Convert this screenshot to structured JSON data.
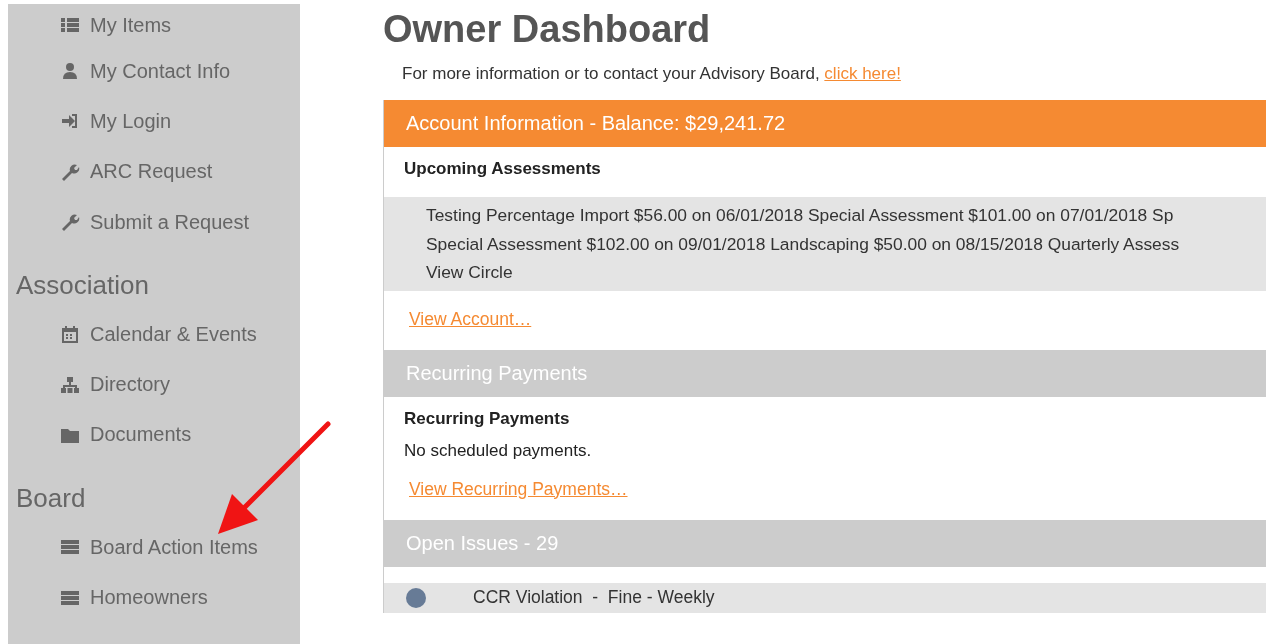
{
  "sidebar": {
    "groups": [
      {
        "items": [
          {
            "label": "My Items",
            "kind": "list"
          },
          {
            "label": "My Contact Info",
            "kind": "user"
          },
          {
            "label": "My Login",
            "kind": "login"
          },
          {
            "label": "ARC Request",
            "kind": "wrench"
          },
          {
            "label": "Submit a Request",
            "kind": "wrench"
          }
        ]
      },
      {
        "heading": "Association",
        "items": [
          {
            "label": "Calendar & Events",
            "kind": "calendar"
          },
          {
            "label": "Directory",
            "kind": "sitemap"
          },
          {
            "label": "Documents",
            "kind": "folder"
          }
        ]
      },
      {
        "heading": "Board",
        "items": [
          {
            "label": "Board Action Items",
            "kind": "server"
          },
          {
            "label": "Homeowners",
            "kind": "server"
          }
        ]
      }
    ]
  },
  "page": {
    "title": "Owner Dashboard",
    "intro": "For more information or to contact your Advisory Board,",
    "intro_link": "click here!"
  },
  "panels": [
    {
      "header": "Account Information - Balance: $29,241.72",
      "color": "#f58a32",
      "subheading": "Upcoming Assessments",
      "lines": [
        "Testing Percentage Import $56.00 on 06/01/2018 Special Assessment $101.00 on 07/01/2018 Sp",
        "Special Assessment $102.00 on 09/01/2018 Landscaping $50.00 on 08/15/2018 Quarterly Assess",
        "View Circle"
      ],
      "link": "View Account…"
    },
    {
      "header": "Recurring Payments",
      "color": "#cccccc",
      "subheading": "Recurring Payments",
      "text": "No scheduled payments.",
      "link": "View Recurring Payments…"
    },
    {
      "header": "Open Issues - 29",
      "color": "#cccccc",
      "issues": [
        {
          "label": "CCR Violation  -  Fine - Weekly",
          "color": "#677b96"
        }
      ]
    }
  ]
}
